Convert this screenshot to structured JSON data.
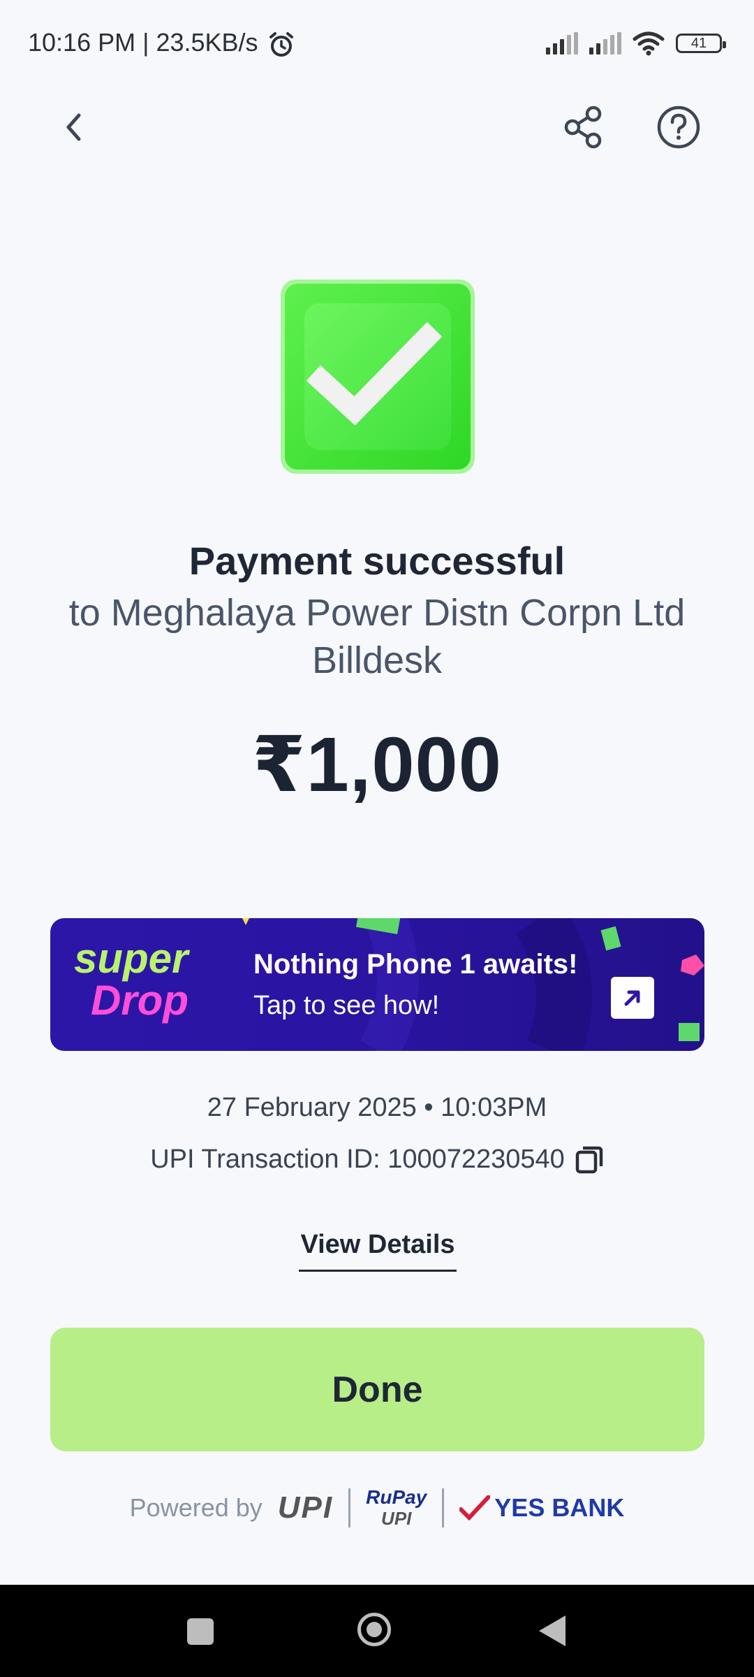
{
  "status_bar": {
    "time_speed": "10:16 PM | 23.5KB/s",
    "battery": "41"
  },
  "header": {
    "back_icon": "chevron-left-icon",
    "share_icon": "share-icon",
    "help_icon": "help-icon"
  },
  "result": {
    "title": "Payment successful",
    "recipient_line1": "to Meghalaya Power Distn Corpn Ltd",
    "recipient_line2": "Billdesk",
    "amount": "₹1,000"
  },
  "banner": {
    "logo_top": "super",
    "logo_bottom": "Drop",
    "headline": "Nothing Phone 1 awaits!",
    "subline": "Tap to see how!"
  },
  "details": {
    "datetime": "27 February 2025 • 10:03PM",
    "transaction_id": "UPI Transaction ID: 100072230540",
    "view_details": "View Details"
  },
  "actions": {
    "done": "Done"
  },
  "footer": {
    "powered_by": "Powered by",
    "upi_logo": "UPI",
    "rupay_logo_top": "RuPay",
    "rupay_logo_bottom": "UPI",
    "bank": "YES BANK"
  },
  "colors": {
    "accent_green": "#b7ee88",
    "banner_purple": "#2c16a8",
    "check_green": "#3ee03a"
  }
}
